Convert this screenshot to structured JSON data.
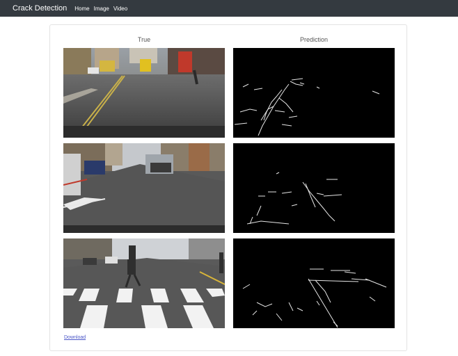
{
  "navbar": {
    "brand": "Crack Detection",
    "links": [
      "Home",
      "Image",
      "Video"
    ]
  },
  "columns": {
    "true_label": "True",
    "prediction_label": "Prediction"
  },
  "footer": {
    "download_label": "Download"
  },
  "colors": {
    "navbar_bg": "#343a40",
    "link": "#4b57c8",
    "prediction_bg": "#000000"
  },
  "rows": [
    {
      "true_image": "street-scene-with-buses",
      "prediction_image": "crack-mask-1"
    },
    {
      "true_image": "street-scene-with-parked-cars",
      "prediction_image": "crack-mask-2"
    },
    {
      "true_image": "crosswalk-with-pedestrian",
      "prediction_image": "crack-mask-3"
    }
  ]
}
